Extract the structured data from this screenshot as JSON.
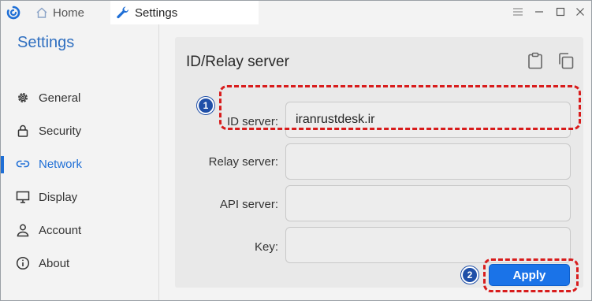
{
  "titlebar": {
    "tabs": [
      {
        "label": "Home",
        "icon": "home-icon"
      },
      {
        "label": "Settings",
        "icon": "wrench-icon"
      }
    ],
    "controls": [
      "menu-icon",
      "minimize-icon",
      "maximize-icon",
      "close-icon"
    ]
  },
  "sidebar": {
    "title": "Settings",
    "items": [
      {
        "label": "General",
        "icon": "gear-icon"
      },
      {
        "label": "Security",
        "icon": "lock-icon"
      },
      {
        "label": "Network",
        "icon": "link-icon",
        "active": true
      },
      {
        "label": "Display",
        "icon": "monitor-icon"
      },
      {
        "label": "Account",
        "icon": "person-icon"
      },
      {
        "label": "About",
        "icon": "info-icon"
      }
    ]
  },
  "main": {
    "card_title": "ID/Relay server",
    "actions": [
      "clipboard-icon",
      "copy-icon"
    ],
    "fields": [
      {
        "label": "ID server:",
        "value": "iranrustdesk.ir"
      },
      {
        "label": "Relay server:",
        "value": ""
      },
      {
        "label": "API server:",
        "value": ""
      },
      {
        "label": "Key:",
        "value": ""
      }
    ],
    "apply_label": "Apply"
  },
  "annotations": {
    "step1": "1",
    "step2": "2"
  },
  "colors": {
    "accent": "#1f6fd6",
    "apply_button": "#1a73e8",
    "highlight": "#d81c1c",
    "badge": "#1f4fa8"
  }
}
